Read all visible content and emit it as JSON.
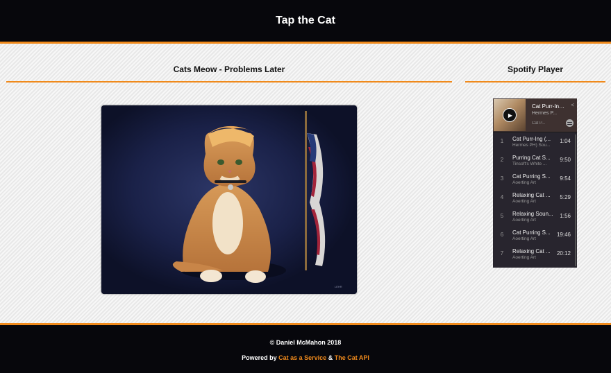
{
  "header": {
    "title": "Tap the Cat"
  },
  "main": {
    "title": "Cats Meow - Problems Later"
  },
  "sidebar": {
    "title": "Spotify Player"
  },
  "player": {
    "now_playing_title": "Cat Purr-Ing (Cat...",
    "now_playing_artist": "Hermes P...",
    "now_playing_sub": "Cat P...",
    "tracks": [
      {
        "num": "1",
        "title": "Cat Purr-Ing (...",
        "artist": "Hermes PH) Sou...",
        "duration": "1:04"
      },
      {
        "num": "2",
        "title": "Purring Cat S...",
        "artist": "Tinsoft's White ...",
        "duration": "9:50"
      },
      {
        "num": "3",
        "title": "Cat Purring S...",
        "artist": "Aoerting Art",
        "duration": "9:54"
      },
      {
        "num": "4",
        "title": "Relaxing Cat ...",
        "artist": "Aoerting Art",
        "duration": "5:29"
      },
      {
        "num": "5",
        "title": "Relaxing Soun...",
        "artist": "Aoerting Art",
        "duration": "1:56"
      },
      {
        "num": "6",
        "title": "Cat Purring S...",
        "artist": "Aoerting Art",
        "duration": "19:46"
      },
      {
        "num": "7",
        "title": "Relaxing Cat ...",
        "artist": "Aoerting Art",
        "duration": "20:12"
      }
    ]
  },
  "footer": {
    "copyright": "© Daniel McMahon 2018",
    "powered_prefix": "Powered by",
    "link1": "Cat as a Service",
    "ampersand": "&",
    "link2": "The Cat API"
  },
  "icons": {
    "play": "play-icon",
    "share": "share-icon",
    "spotify": "spotify-logo-icon"
  },
  "colors": {
    "accent": "#f08a1c",
    "bar": "#07070c",
    "player_bg": "#28252e"
  }
}
